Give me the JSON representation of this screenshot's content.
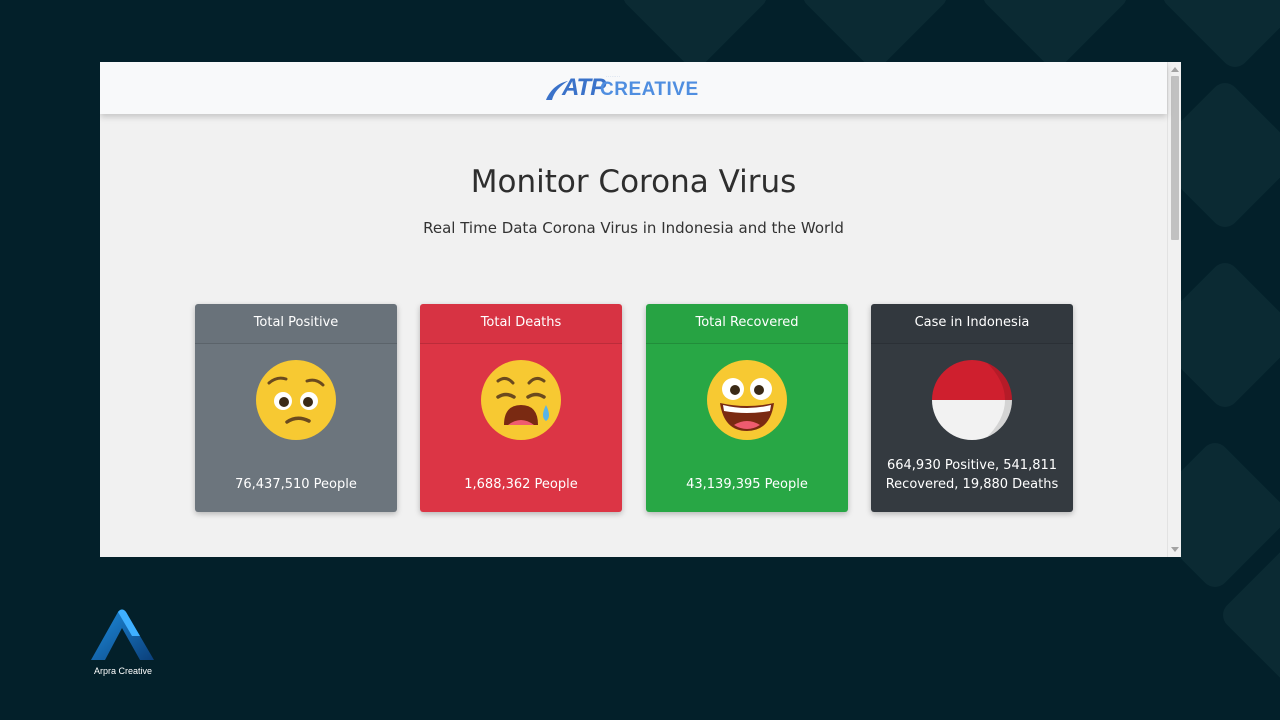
{
  "navbar": {
    "logo_main": "ATP",
    "logo_sub": "CREATIVE"
  },
  "hero": {
    "title": "Monitor Corona Virus",
    "subtitle": "Real Time Data Corona Virus in Indonesia and the World"
  },
  "cards": [
    {
      "title": "Total Positive",
      "value": "76,437,510 People",
      "color": "#6c757d",
      "icon": "worried-face-icon"
    },
    {
      "title": "Total Deaths",
      "value": "1,688,362 People",
      "color": "#dc3545",
      "icon": "crying-face-icon"
    },
    {
      "title": "Total Recovered",
      "value": "43,139,395 People",
      "color": "#28a745",
      "icon": "grinning-face-icon"
    },
    {
      "title": "Case in Indonesia",
      "value_line1": "664,930 Positive, 541,811",
      "value_line2": "Recovered, 19,880 Deaths",
      "color": "#343a40",
      "icon": "indonesia-flag-icon"
    }
  ],
  "brand": {
    "name": "Arpra Creative"
  },
  "colors": {
    "background": "#03202a",
    "page": "#f1f1f1",
    "logo_blue": "#3a72c9"
  }
}
